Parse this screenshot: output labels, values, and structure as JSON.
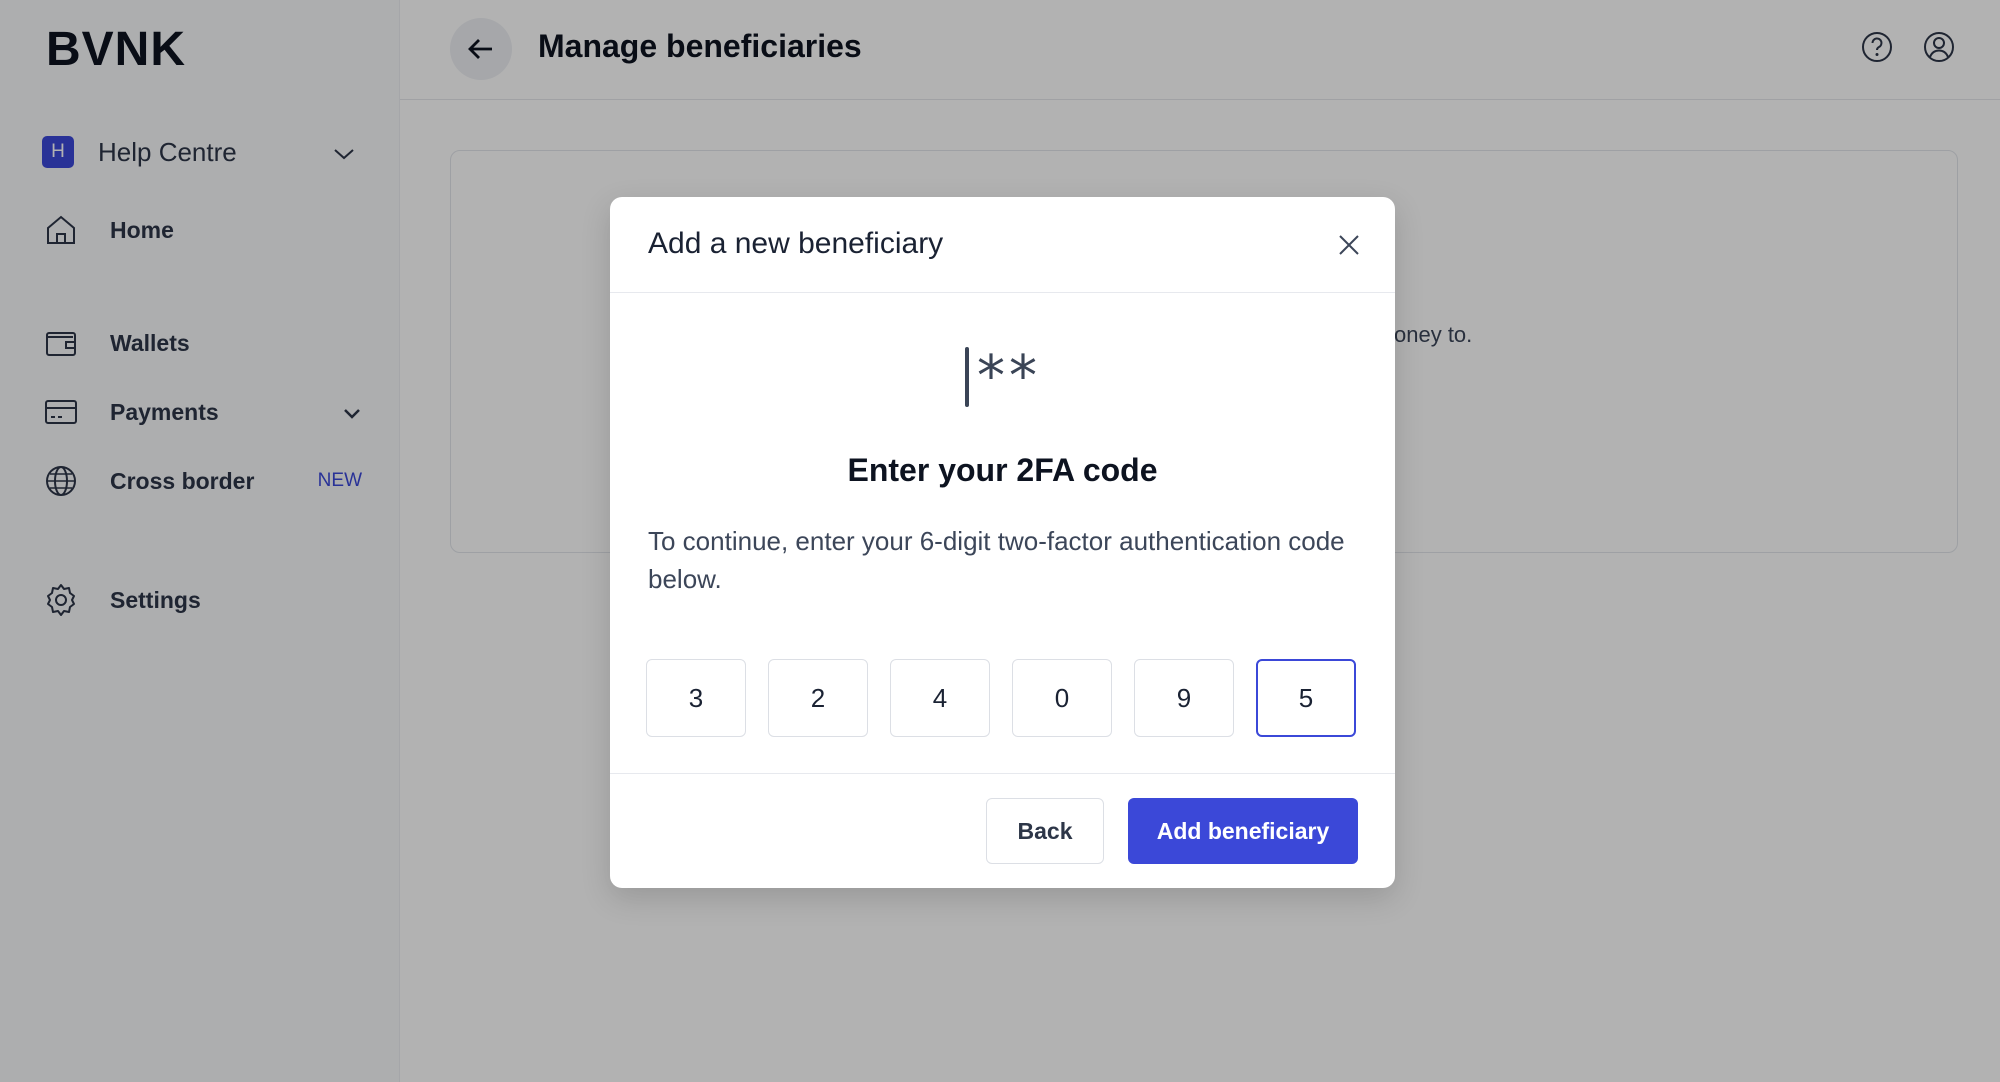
{
  "brand": {
    "logo": "BVNK",
    "accent": "#3b48d8"
  },
  "sidebar": {
    "workspace": {
      "badge": "H",
      "label": "Help Centre",
      "icon": "chevron-down-icon"
    },
    "items": [
      {
        "label": "Home",
        "icon": "home-icon"
      },
      {
        "label": "Wallets",
        "icon": "wallet-icon"
      },
      {
        "label": "Payments",
        "icon": "card-icon",
        "has_submenu": true
      },
      {
        "label": "Cross border",
        "icon": "globe-icon",
        "badge": "NEW"
      },
      {
        "label": "Settings",
        "icon": "gear-icon"
      }
    ]
  },
  "header": {
    "title": "Manage beneficiaries",
    "icons": [
      "back-arrow-icon",
      "help-icon",
      "user-icon"
    ]
  },
  "card": {
    "partial_text": "oney to."
  },
  "modal": {
    "title": "Add a new beneficiary",
    "illustration": "**",
    "heading": "Enter your 2FA code",
    "description": "To continue, enter your 6-digit two-factor authentication code below.",
    "code_digits": [
      "3",
      "2",
      "4",
      "0",
      "9",
      "5"
    ],
    "back_label": "Back",
    "submit_label": "Add beneficiary"
  }
}
